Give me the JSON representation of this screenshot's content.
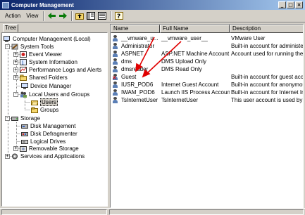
{
  "window": {
    "title": "Computer Management"
  },
  "menu": {
    "action": "Action",
    "view": "View"
  },
  "icons": {
    "back": "back-arrow-icon",
    "forward": "forward-arrow-icon",
    "up": "up-folder-icon",
    "show_tree": "show-hide-tree-icon",
    "export": "export-list-icon",
    "help": "help-icon"
  },
  "tabs": {
    "tree": "Tree"
  },
  "tree": {
    "root": "Computer Management (Local)",
    "system_tools": "System Tools",
    "event_viewer": "Event Viewer",
    "system_information": "System Information",
    "performance_logs": "Performance Logs and Alerts",
    "shared_folders": "Shared Folders",
    "device_manager": "Device Manager",
    "local_users": "Local Users and Groups",
    "users": "Users",
    "groups": "Groups",
    "storage": "Storage",
    "disk_management": "Disk Management",
    "disk_defrag": "Disk Defragmenter",
    "logical_drives": "Logical Drives",
    "removable_storage": "Removable Storage",
    "services": "Services and Applications"
  },
  "columns": {
    "name": "Name",
    "full_name": "Full Name",
    "description": "Description"
  },
  "users": [
    {
      "name": "__vmware_u...",
      "full_name": "__vmware_user__",
      "description": "VMware User",
      "disabled": false
    },
    {
      "name": "Administrator",
      "full_name": "",
      "description": "Built-in account for administering",
      "disabled": false
    },
    {
      "name": "ASPNET",
      "full_name": "ASP.NET Machine Account",
      "description": "Account used for running the A",
      "disabled": false
    },
    {
      "name": "dms",
      "full_name": "DMS Upload Only",
      "description": "",
      "disabled": false
    },
    {
      "name": "dmsreader",
      "full_name": "DMS Read Only",
      "description": "",
      "disabled": false
    },
    {
      "name": "Guest",
      "full_name": "",
      "description": "Built-in account for guest acces",
      "disabled": true
    },
    {
      "name": "IUSR_POD6",
      "full_name": "Internet Guest Account",
      "description": "Built-in account for anonymous",
      "disabled": false
    },
    {
      "name": "IWAM_POD6",
      "full_name": "Launch IIS Process Account",
      "description": "Built-in account for Internet In",
      "disabled": false
    },
    {
      "name": "TsInternetUser",
      "full_name": "TsInternetUser",
      "description": "This user account is used by Te",
      "disabled": false
    }
  ],
  "colors": {
    "annotation_arrow": "#e00000",
    "title_start": "#0a246a",
    "title_end": "#a6caf0"
  }
}
